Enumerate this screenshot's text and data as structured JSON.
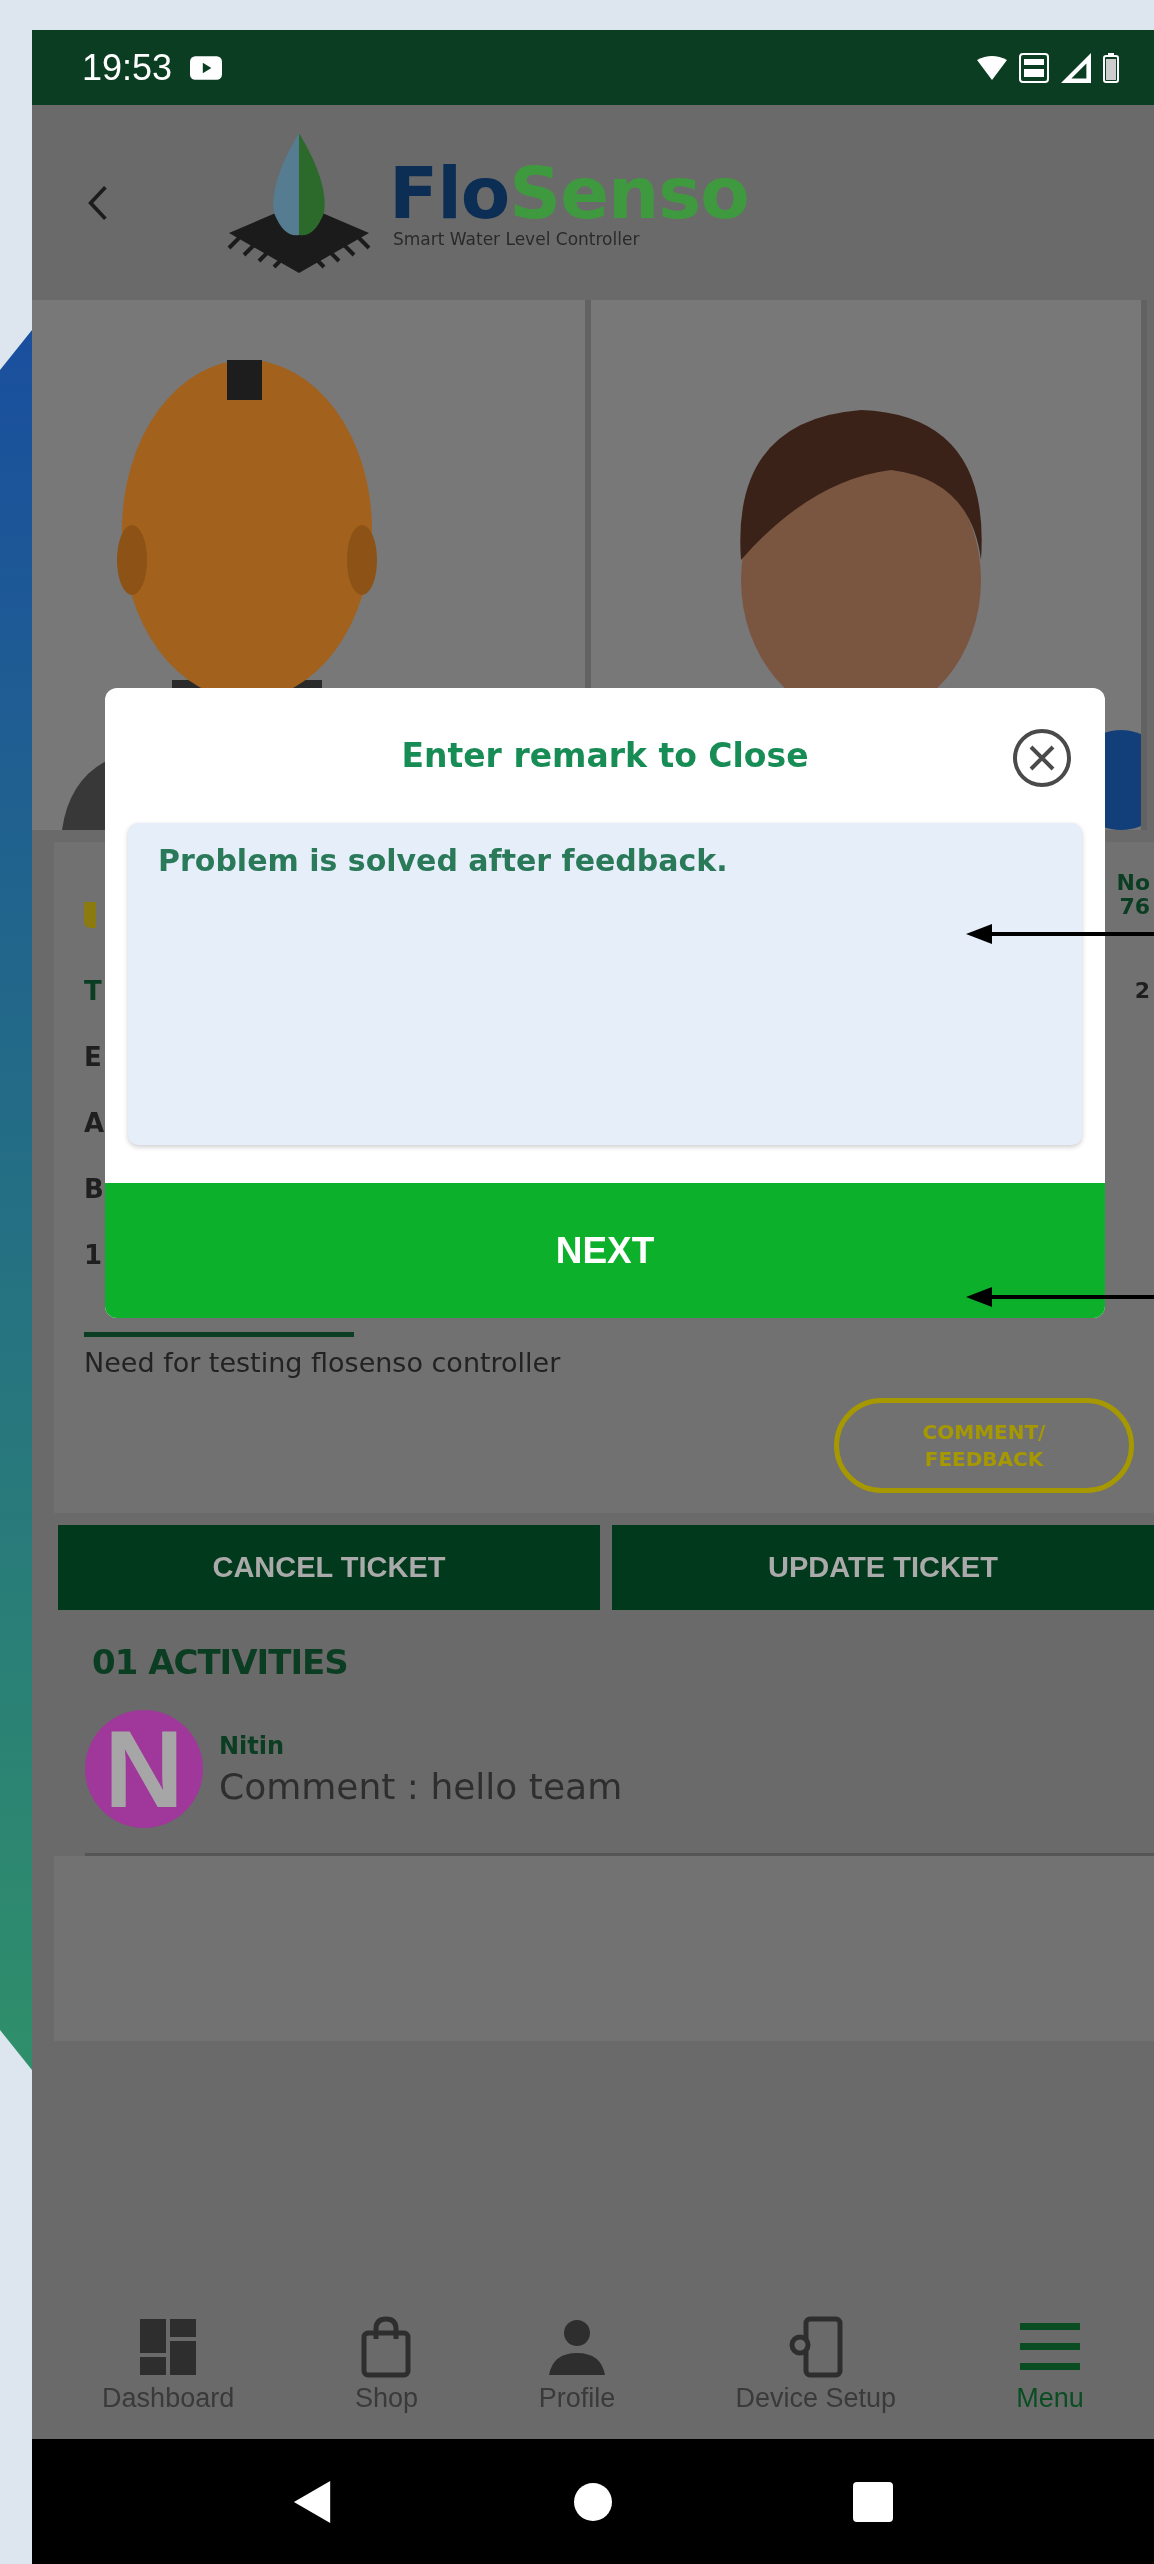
{
  "status_bar": {
    "time": "19:53"
  },
  "header": {
    "logo": {
      "name_first": "Flo",
      "name_second": "Senso",
      "tagline": "Smart Water Level Controller"
    }
  },
  "ticket": {
    "left_fragments": [
      "T",
      "E",
      "A",
      "B",
      "1"
    ],
    "right_fragments": [
      "No",
      "76",
      "2"
    ],
    "description": "Need for testing flosenso controller",
    "feedback_button": "COMMENT/\nFEEDBACK"
  },
  "actions": [
    "CANCEL TICKET",
    "UPDATE TICKET"
  ],
  "activities": {
    "title": "01 ACTIVITIES",
    "items": [
      {
        "initial": "N",
        "author": "Nitin",
        "text": "Comment : hello team"
      }
    ]
  },
  "dialog": {
    "title": "Enter remark to Close",
    "remark": "Problem is solved after feedback.",
    "next_label": "NEXT"
  },
  "bottom_nav": [
    {
      "label": "Dashboard",
      "kind": "dashboard",
      "selected": false
    },
    {
      "label": "Shop",
      "kind": "shop",
      "selected": false
    },
    {
      "label": "Profile",
      "kind": "profile",
      "selected": false
    },
    {
      "label": "Device Setup",
      "kind": "device",
      "selected": false
    },
    {
      "label": "Menu",
      "kind": "menu",
      "selected": true
    }
  ]
}
